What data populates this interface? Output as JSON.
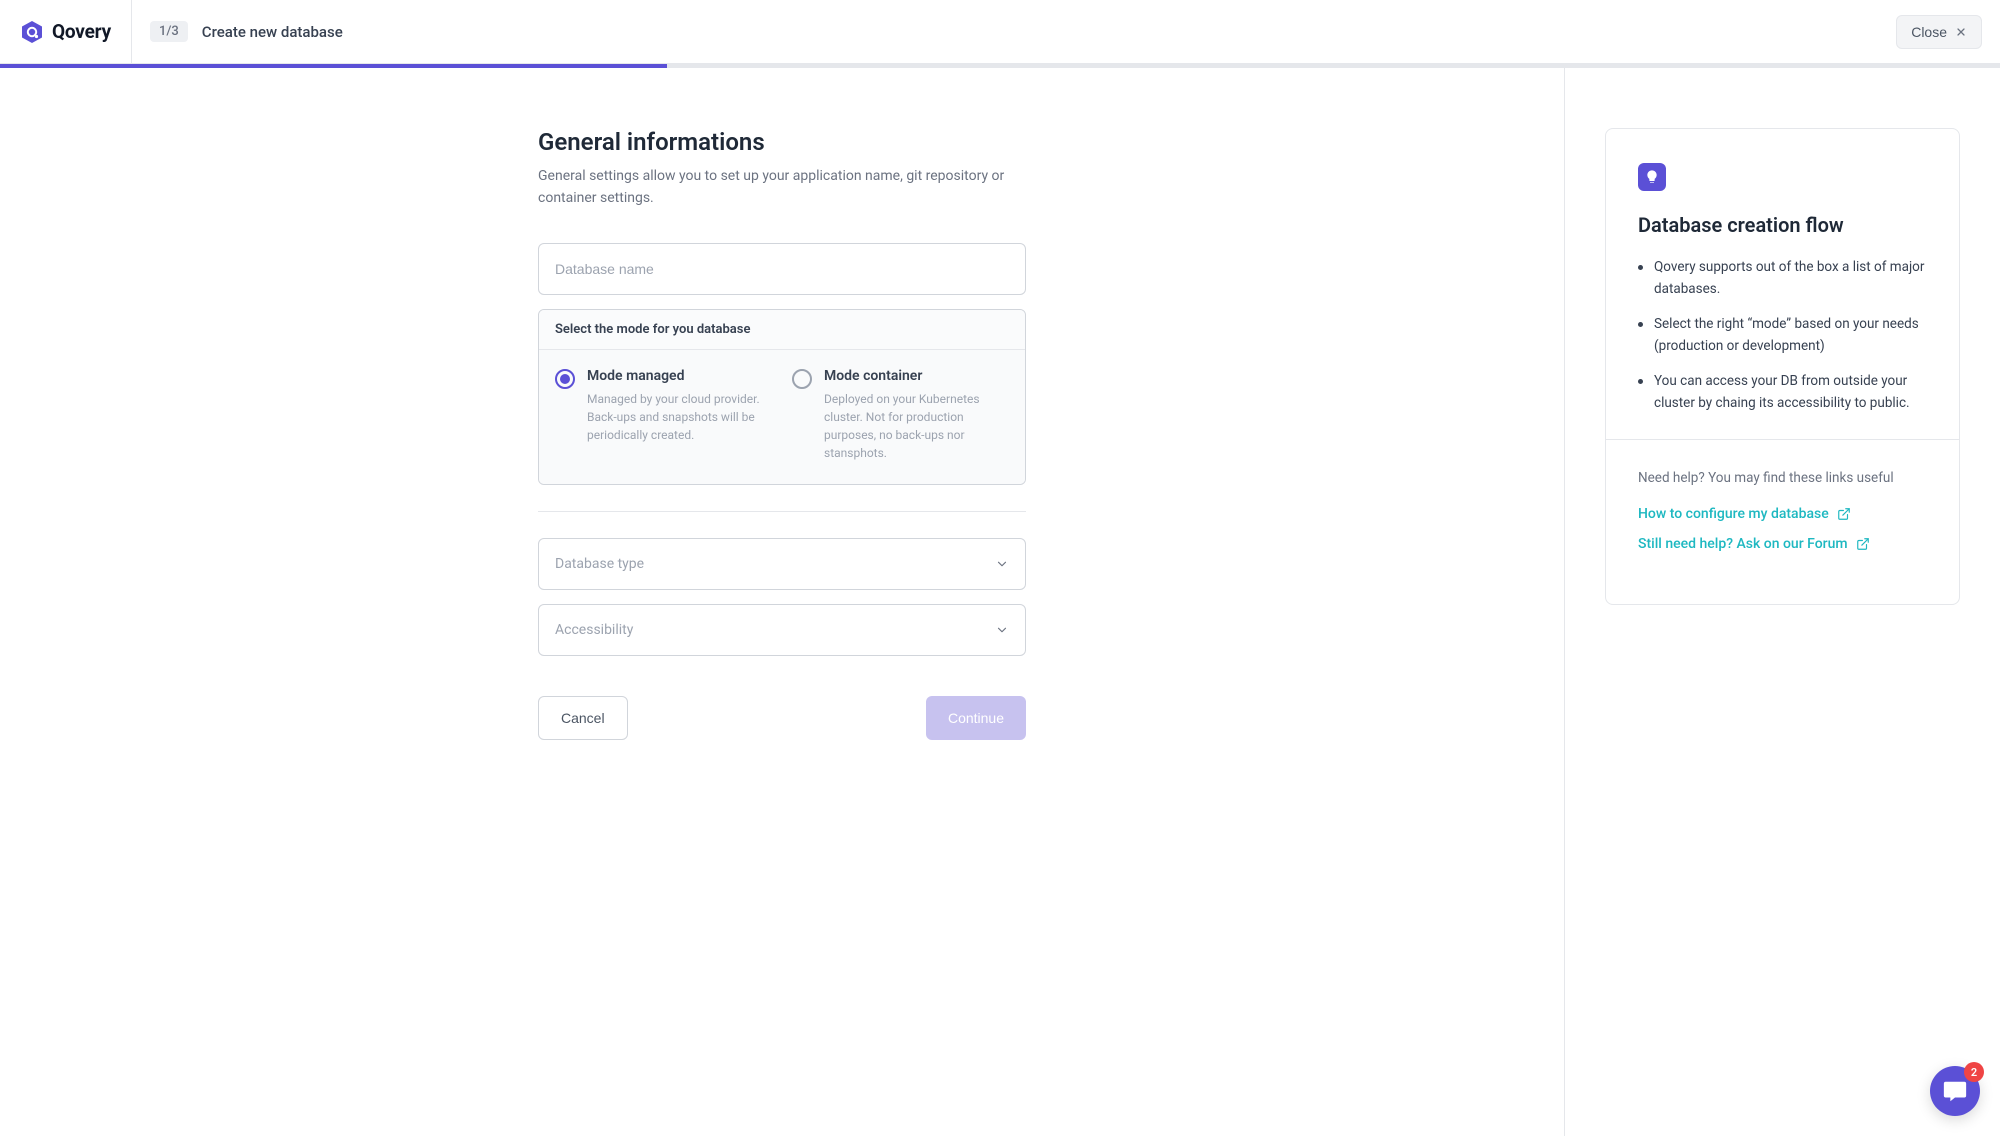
{
  "header": {
    "brand": "Qovery",
    "step": "1/3",
    "title": "Create new database",
    "close": "Close"
  },
  "progress": {
    "percent": 33.33
  },
  "form": {
    "heading": "General informations",
    "description": "General settings allow you to set up your application name, git repository or container settings.",
    "name_placeholder": "Database name",
    "mode_section_label": "Select the mode for you database",
    "modes": [
      {
        "key": "managed",
        "title": "Mode managed",
        "subtitle": "Managed by your cloud provider. Back-ups and snapshots will be periodically created.",
        "selected": true
      },
      {
        "key": "container",
        "title": "Mode container",
        "subtitle": "Deployed on your Kubernetes cluster. Not for production purposes, no back-ups nor stansphots.",
        "selected": false
      }
    ],
    "type_placeholder": "Database type",
    "accessibility_placeholder": "Accessibility",
    "cancel": "Cancel",
    "continue": "Continue"
  },
  "sidebar": {
    "title": "Database creation flow",
    "bullets": [
      "Qovery supports out of the box a list of major databases.",
      "Select the right “mode” based on your needs (production or development)",
      "You can access your DB from outside your cluster by chaing its accessibility to public."
    ],
    "help_intro": "Need help? You may find these links useful",
    "links": [
      "How to configure my database",
      "Still need help? Ask on our Forum"
    ]
  },
  "chat": {
    "unread": 2
  }
}
